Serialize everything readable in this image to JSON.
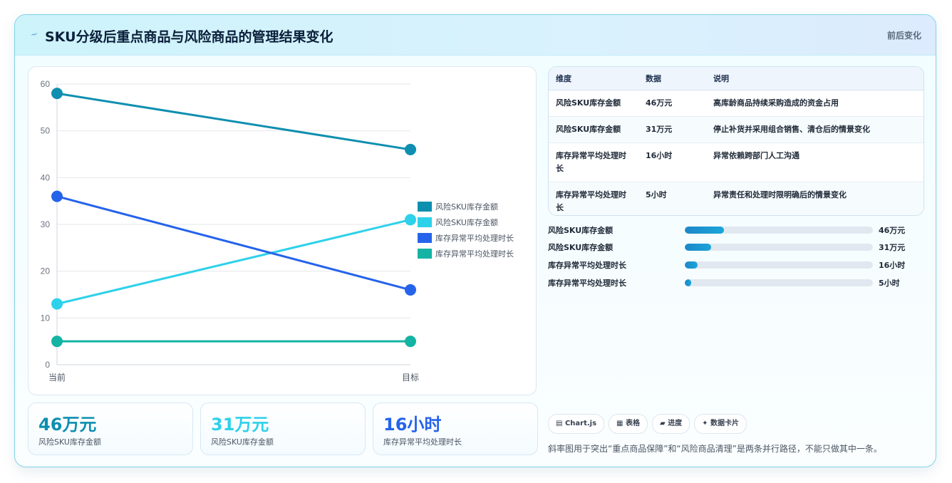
{
  "header": {
    "title": "SKU分级后重点商品与风险商品的管理结果变化",
    "tag": "前后变化"
  },
  "chart_data": {
    "type": "line",
    "x": [
      "当前",
      "目标"
    ],
    "ylim": [
      0,
      60
    ],
    "yticks": [
      0,
      10,
      20,
      30,
      40,
      50,
      60
    ],
    "grid": true,
    "legend": "right",
    "series": [
      {
        "name": "风险SKU库存金额",
        "values": [
          58,
          46
        ],
        "color": "#0e8fb0"
      },
      {
        "name": "风险SKU库存金额",
        "values": [
          13,
          31
        ],
        "color": "#2dd1ea"
      },
      {
        "name": "库存异常平均处理时长",
        "values": [
          36,
          16
        ],
        "color": "#2563eb"
      },
      {
        "name": "库存异常平均处理时长",
        "values": [
          5,
          5
        ],
        "color": "#14b3a3"
      }
    ]
  },
  "kpis": [
    {
      "value": "46万元",
      "label": "风险SKU库存金额",
      "color": "#0e8fb0"
    },
    {
      "value": "31万元",
      "label": "风险SKU库存金额",
      "color": "#2dd1ea"
    },
    {
      "value": "16小时",
      "label": "库存异常平均处理时长",
      "color": "#2563eb"
    }
  ],
  "table": {
    "headers": [
      "维度",
      "数据",
      "说明"
    ],
    "rows": [
      [
        "风险SKU库存金额",
        "46万元",
        "高库龄商品持续采购造成的资金占用"
      ],
      [
        "风险SKU库存金额",
        "31万元",
        "停止补货并采用组合销售、清仓后的情景变化"
      ],
      [
        "库存异常平均处理时长",
        "16小时",
        "异常依赖跨部门人工沟通"
      ],
      [
        "库存异常平均处理时长",
        "5小时",
        "异常责任和处理时限明确后的情景变化"
      ]
    ]
  },
  "progress": [
    {
      "label": "风险SKU库存金额",
      "value": "46万元",
      "fraction": 0.21
    },
    {
      "label": "风险SKU库存金额",
      "value": "31万元",
      "fraction": 0.14
    },
    {
      "label": "库存异常平均处理时长",
      "value": "16小时",
      "fraction": 0.07
    },
    {
      "label": "库存异常平均处理时长",
      "value": "5小时",
      "fraction": 0.035
    }
  ],
  "chips": [
    "Chart.js",
    "表格",
    "进度",
    "数据卡片"
  ],
  "chip_icons": [
    "chart-icon",
    "table-icon",
    "progress-icon",
    "card-icon"
  ],
  "footnote": "斜率图用于突出“重点商品保障”和“风险商品清理”是两条并行路径，不能只做其中一条。"
}
